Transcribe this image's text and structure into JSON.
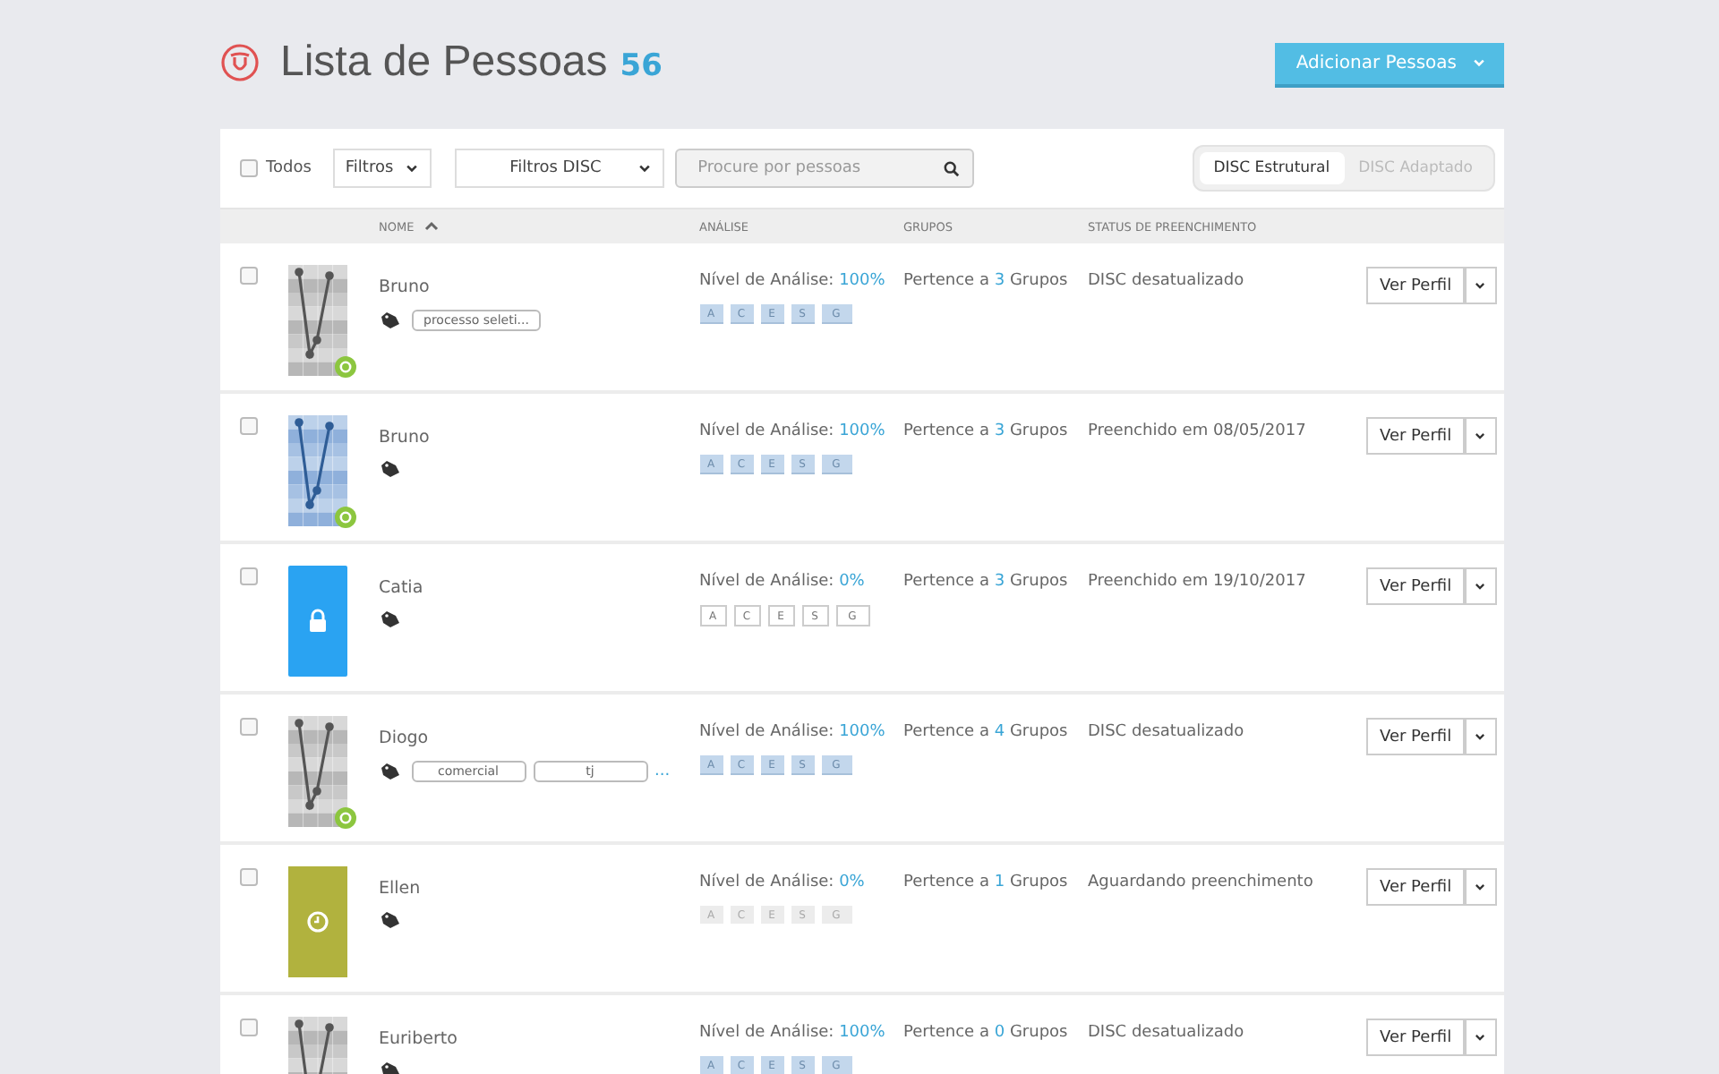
{
  "header": {
    "title": "Lista de Pessoas",
    "count": "56",
    "add_button": "Adicionar Pessoas"
  },
  "toolbar": {
    "select_all": {
      "label": "Todos",
      "checked": false
    },
    "filters": "Filtros",
    "disc_filters": "Filtros DISC",
    "search": {
      "placeholder": "Procure por pessoas"
    },
    "view_toggle": [
      {
        "label": "DISC Estrutural",
        "selected": true
      },
      {
        "label": "DISC Adaptado",
        "selected": false
      }
    ]
  },
  "table": {
    "columns": [
      "NOME",
      "ANÁLISE",
      "GRUPOS",
      "STATUS DE PREENCHIMENTO"
    ],
    "rows": [
      {
        "name": "Bruno",
        "checked": false,
        "avatar": {
          "kind": "chart-gray",
          "badge": true
        },
        "tags": [
          "processo seleti..."
        ],
        "analysis_label": "Nível de Análise:",
        "analysis_value": "100%",
        "factors": {
          "kind": "filled",
          "letters": [
            "A",
            "C",
            "E",
            "S",
            "G"
          ]
        },
        "groups_prefix": "Pertence a",
        "groups_count": "3",
        "groups_suffix": "Grupos",
        "status": "DISC desatualizado",
        "action": "Ver Perfil"
      },
      {
        "name": "Bruno",
        "checked": false,
        "avatar": {
          "kind": "chart-blue",
          "badge": true
        },
        "tags": [],
        "analysis_label": "Nível de Análise:",
        "analysis_value": "100%",
        "factors": {
          "kind": "filled",
          "letters": [
            "A",
            "C",
            "E",
            "S",
            "G"
          ]
        },
        "groups_prefix": "Pertence a",
        "groups_count": "3",
        "groups_suffix": "Grupos",
        "status": "Preenchido em 08/05/2017",
        "action": "Ver Perfil"
      },
      {
        "name": "Catia",
        "checked": false,
        "avatar": {
          "kind": "locked",
          "badge": false
        },
        "tags": [],
        "analysis_label": "Nível de Análise:",
        "analysis_value": "0%",
        "factors": {
          "kind": "outline",
          "letters": [
            "A",
            "C",
            "E",
            "S",
            "G"
          ]
        },
        "groups_prefix": "Pertence a",
        "groups_count": "3",
        "groups_suffix": "Grupos",
        "status": "Preenchido em 19/10/2017",
        "action": "Ver Perfil"
      },
      {
        "name": "Diogo",
        "checked": false,
        "avatar": {
          "kind": "chart-gray",
          "badge": true
        },
        "tags": [
          "comercial",
          "tj"
        ],
        "more_tags": "...",
        "analysis_label": "Nível de Análise:",
        "analysis_value": "100%",
        "factors": {
          "kind": "filled",
          "letters": [
            "A",
            "C",
            "E",
            "S",
            "G"
          ]
        },
        "groups_prefix": "Pertence a",
        "groups_count": "4",
        "groups_suffix": "Grupos",
        "status": "DISC desatualizado",
        "action": "Ver Perfil"
      },
      {
        "name": "Ellen",
        "checked": false,
        "avatar": {
          "kind": "pending",
          "badge": false
        },
        "tags": [],
        "analysis_label": "Nível de Análise:",
        "analysis_value": "0%",
        "factors": {
          "kind": "faded",
          "letters": [
            "A",
            "C",
            "E",
            "S",
            "G"
          ]
        },
        "groups_prefix": "Pertence a",
        "groups_count": "1",
        "groups_suffix": "Grupos",
        "status": "Aguardando preenchimento",
        "action": "Ver Perfil"
      },
      {
        "name": "Euriberto",
        "checked": false,
        "avatar": {
          "kind": "chart-gray",
          "badge": false
        },
        "tags": [],
        "analysis_label": "Nível de Análise:",
        "analysis_value": "100%",
        "factors": {
          "kind": "filled",
          "letters": [
            "A",
            "C",
            "E",
            "S",
            "G"
          ]
        },
        "groups_prefix": "Pertence a",
        "groups_count": "0",
        "groups_suffix": "Grupos",
        "status": "DISC desatualizado",
        "action": "Ver Perfil"
      }
    ]
  }
}
